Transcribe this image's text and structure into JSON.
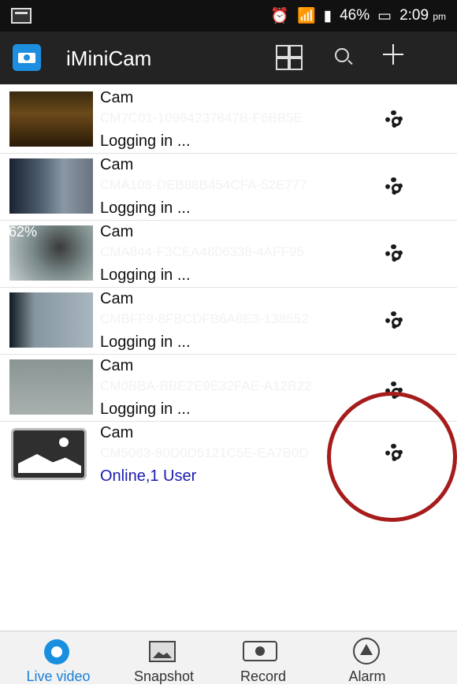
{
  "status_bar": {
    "battery": "46%",
    "time": "2:09",
    "ampm": "pm"
  },
  "app_bar": {
    "title": "iMiniCam"
  },
  "cameras": [
    {
      "name": "Cam",
      "uid": "CM7C01-10964237847B-F6BB5E",
      "status": "Logging in ..."
    },
    {
      "name": "Cam",
      "uid": "CMA108-DEB88B454CFA-52E777",
      "status": "Logging in ..."
    },
    {
      "name": "Cam",
      "uid": "CMA844-F3CEA4806338-4AFF95",
      "status": "Logging in ...",
      "overlay": "62%"
    },
    {
      "name": "Cam",
      "uid": "CMBFF9-8FBCDFB6A8E3-138552",
      "status": "Logging in ..."
    },
    {
      "name": "Cam",
      "uid": "CM0BBA-BBE2E9E32FAE-A12B22",
      "status": "Logging in ..."
    },
    {
      "name": "Cam",
      "uid": "CM5063-80D0D5121C5E-EA7B0D",
      "status": "Online,1 User"
    }
  ],
  "bottom_nav": [
    {
      "label": "Live video",
      "icon": "live-video-icon"
    },
    {
      "label": "Snapshot",
      "icon": "snapshot-icon"
    },
    {
      "label": "Record",
      "icon": "record-icon"
    },
    {
      "label": "Alarm",
      "icon": "alarm-icon"
    }
  ]
}
